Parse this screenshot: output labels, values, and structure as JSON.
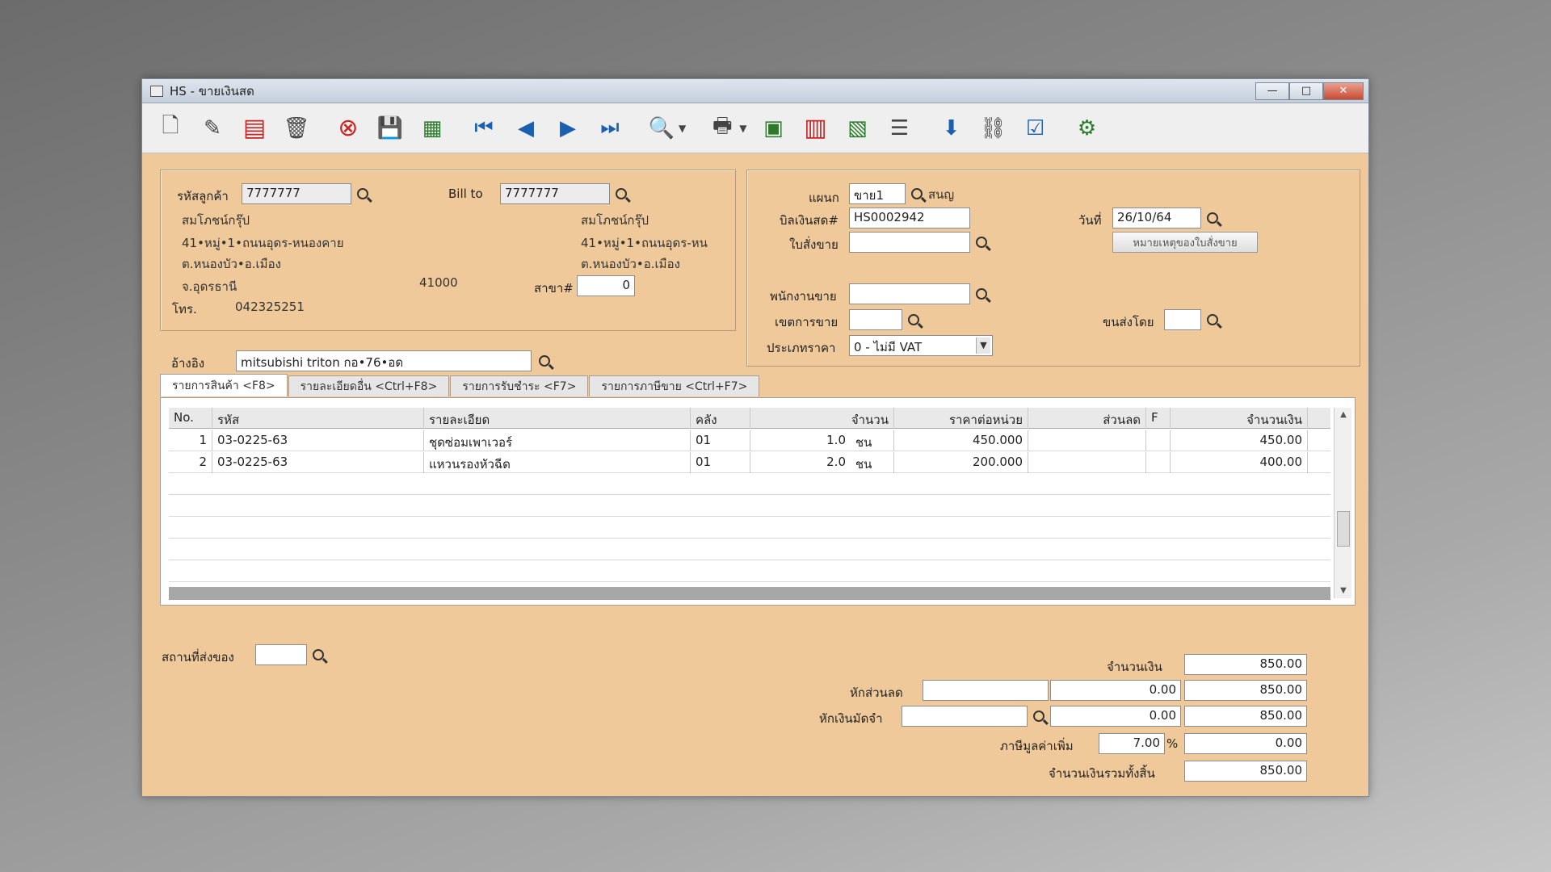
{
  "window": {
    "title": "HS - ขายเงินสด",
    "minimize": "—",
    "maximize": "□",
    "close": "✕"
  },
  "toolbar": {
    "icons": [
      "new-doc-icon",
      "edit-icon",
      "void-icon",
      "trash-icon",
      "cancel-icon",
      "save-icon",
      "money-icon",
      "first-icon",
      "prev-icon",
      "next-icon",
      "last-icon",
      "search-doc-icon",
      "print-icon",
      "calculator-icon",
      "register-icon",
      "so-icon",
      "report-icon",
      "approve-icon",
      "link-icon",
      "ok-icon",
      "settings-icon"
    ]
  },
  "customer": {
    "code_label": "รหัสลูกค้า",
    "code_value": "7777777",
    "bill_to_label": "Bill to",
    "bill_to_value": "7777777",
    "name": "สมโภชน์กรุ๊ป",
    "address1": "41•หมู่•1•ถนนอุดร-หนองคาย",
    "address2": "ต.หนองบัว•อ.เมือง",
    "address3": "จ.อุดรธานี",
    "postcode": "41000",
    "bill_name": "สมโภชน์กรุ๊ป",
    "bill_address1": "41•หมู่•1•ถนนอุดร-หน",
    "bill_address2": "ต.หนองบัว•อ.เมือง",
    "branch_label": "สาขา#",
    "branch_value": "0",
    "phone_label": "โทร.",
    "phone_value": "042325251",
    "ref_label": "อ้างอิง",
    "ref_value": "mitsubishi triton กอ•76•อด"
  },
  "doc": {
    "dept_label": "แผนก",
    "dept_value": "ขาย1",
    "dept_name": "สนญ",
    "bill_label": "บิลเงินสด#",
    "bill_value": "HS0002942",
    "date_label": "วันที่",
    "date_value": "26/10/64",
    "order_label": "ใบสั่งขาย",
    "order_value": "",
    "note_button": "หมายเหตุของใบสั่งขาย",
    "salesman_label": "พนักงานขาย",
    "salesman_value": "",
    "area_label": "เขตการขาย",
    "area_value": "",
    "ship_label": "ขนส่งโดย",
    "ship_value": "",
    "price_type_label": "ประเภทราคา",
    "price_type_value": "0 - ไม่มี VAT"
  },
  "tabs": [
    {
      "label": "รายการสินค้า <F8>"
    },
    {
      "label": "รายละเอียดอื่น <Ctrl+F8>"
    },
    {
      "label": "รายการรับชำระ <F7>"
    },
    {
      "label": "รายการภาษีขาย <Ctrl+F7>"
    }
  ],
  "grid": {
    "headers": [
      "No.",
      "รหัส",
      "รายละเอียด",
      "คลัง",
      "จำนวน",
      "ราคาต่อหน่วย",
      "ส่วนลด",
      "F",
      "จำนวนเงิน"
    ],
    "rows": [
      {
        "no": "1",
        "code": "03-0225-63",
        "desc": "ชุดซ่อมเพาเวอร์",
        "wh": "01",
        "qty": "1.0",
        "unit": "ชน",
        "price": "450.000",
        "disc": "",
        "f": "",
        "amount": "450.00"
      },
      {
        "no": "2",
        "code": "03-0225-63",
        "desc": "แหวนรองหัวฉีด",
        "wh": "01",
        "qty": "2.0",
        "unit": "ชน",
        "price": "200.000",
        "disc": "",
        "f": "",
        "amount": "400.00"
      }
    ]
  },
  "footer": {
    "delivery_label": "สถานที่ส่งของ",
    "delivery_value": "",
    "amount_label": "จำนวนเงิน",
    "amount_value": "850.00",
    "discount_label": "หักส่วนลด",
    "discount_text": "",
    "discount_value": "0.00",
    "after_discount": "850.00",
    "deposit_label": "หักเงินมัดจำ",
    "deposit_text": "",
    "deposit_value": "0.00",
    "after_deposit": "850.00",
    "vat_label": "ภาษีมูลค่าเพิ่ม",
    "vat_rate": "7.00",
    "vat_pct": "%",
    "vat_value": "0.00",
    "total_label": "จำนวนเงินรวมทั้งสิ้น",
    "total_value": "850.00"
  }
}
